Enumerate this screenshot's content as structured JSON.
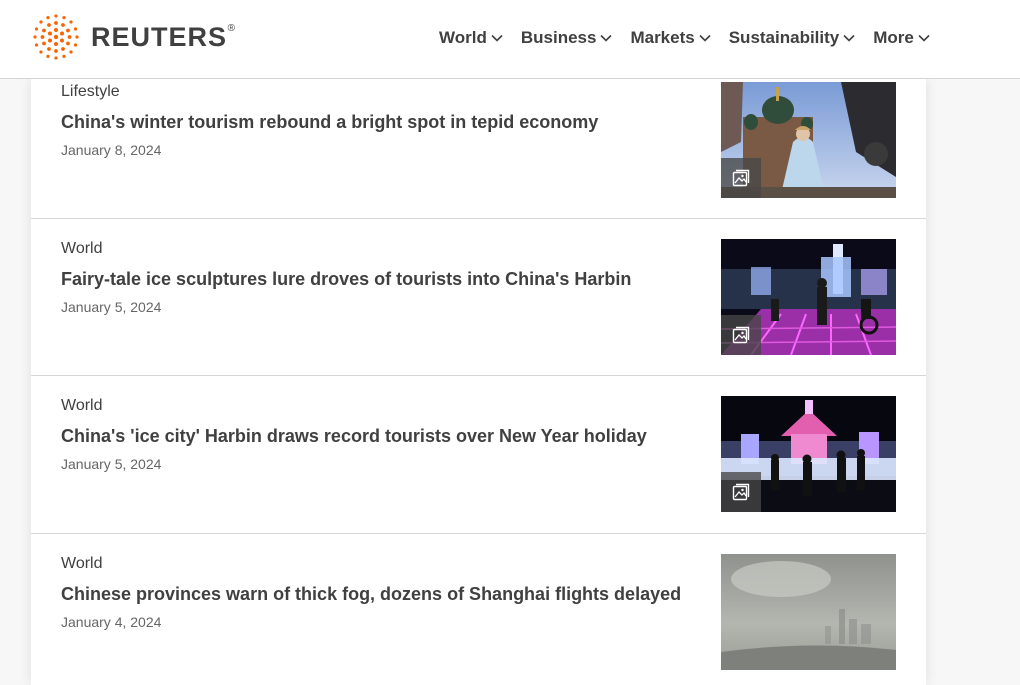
{
  "brand": {
    "name": "REUTERS",
    "reg": "®",
    "accent": "#fa6400"
  },
  "nav": [
    {
      "label": "World"
    },
    {
      "label": "Business"
    },
    {
      "label": "Markets"
    },
    {
      "label": "Sustainability"
    },
    {
      "label": "More"
    }
  ],
  "stories": [
    {
      "kicker": "Lifestyle",
      "headline": "China's winter tourism rebound a bright spot in tepid economy",
      "date": "January 8, 2024",
      "thumb_icon": "gallery-icon"
    },
    {
      "kicker": "World",
      "headline": "Fairy-tale ice sculptures lure droves of tourists into China's Harbin",
      "date": "January 5, 2024",
      "thumb_icon": "gallery-icon"
    },
    {
      "kicker": "World",
      "headline": "China's 'ice city' Harbin draws record tourists over New Year holiday",
      "date": "January 5, 2024",
      "thumb_icon": "gallery-icon"
    },
    {
      "kicker": "World",
      "headline": "Chinese provinces warn of thick fog, dozens of Shanghai flights delayed",
      "date": "January 4, 2024"
    }
  ]
}
